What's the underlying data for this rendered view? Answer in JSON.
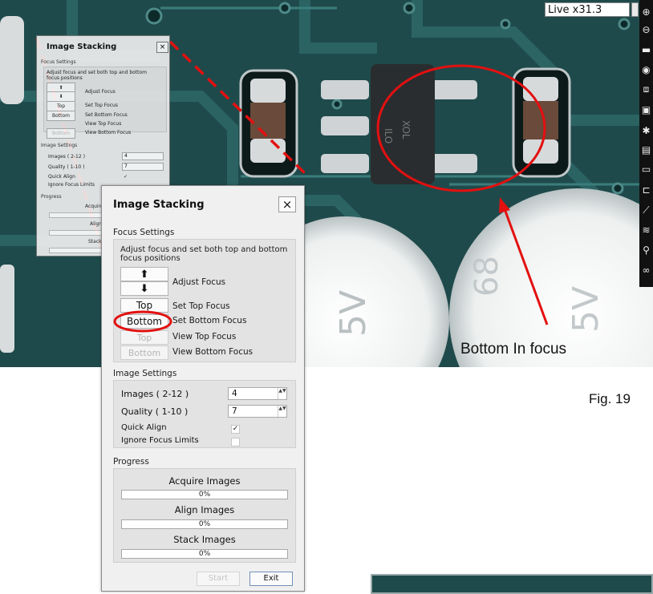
{
  "viewer": {
    "zoom": "Live x31.3",
    "toolbar_icons": [
      "zoom-in-icon",
      "zoom-out-icon",
      "toggle-icon",
      "camera-icon",
      "fit-icon",
      "expand-icon",
      "settings-icon",
      "save-icon",
      "folder-icon",
      "measure-icon",
      "ruler-icon",
      "layers-icon",
      "search-icon",
      "glasses-icon"
    ],
    "annotation_text": "Bottom In focus",
    "colors": {
      "pcb": "#1f4a4b",
      "annotation": "#e31010",
      "pads": "#cfd3d6"
    }
  },
  "mini_dialog": {
    "title": "Image Stacking",
    "close": "×",
    "focus_section": "Focus Settings",
    "hint": "Adjust focus and set both top and bottom focus positions",
    "buttons": {
      "up": "⬆",
      "down": "⬇",
      "top": "Top",
      "bottom": "Bottom",
      "bottom_dim": "Bottom"
    },
    "labels": {
      "adjust": "Adjust Focus",
      "set_top": "Set Top Focus",
      "set_bottom": "Set Bottom Focus",
      "view_top": "View Top Focus",
      "view_bottom": "View Bottom Focus"
    },
    "image_section": "Image Settings",
    "images_label": "Images ( 2-12 )",
    "images_value": "4",
    "quality_label": "Quality ( 1-10 )",
    "quality_value": "7",
    "quick_align": "Quick Align",
    "quick_align_check": "✓",
    "ignore_limits": "Ignore Focus Limits",
    "progress_section": "Progress",
    "acquire": "Acquire",
    "align": "Align",
    "stack": "Stack"
  },
  "dialog": {
    "title": "Image Stacking",
    "close": "×",
    "focus_section": "Focus Settings",
    "hint": "Adjust focus and set both top and bottom focus positions",
    "up_icon": "⬆",
    "down_icon": "⬇",
    "adjust_focus": "Adjust Focus",
    "top_button": "Top",
    "set_top": "Set Top Focus",
    "bottom_button": "Bottom",
    "set_bottom": "Set Bottom Focus",
    "top_disabled": "Top",
    "view_top": "View Top Focus",
    "bottom_disabled": "Bottom",
    "view_bottom": "View Bottom Focus",
    "image_section": "Image Settings",
    "images_label": "Images ( 2-12 )",
    "images_value": "4",
    "quality_label": "Quality ( 1-10 )",
    "quality_value": "7",
    "spin_arrows": "▲▼",
    "quick_align": "Quick Align",
    "quick_align_check": "✓",
    "ignore_limits": "Ignore Focus Limits",
    "progress_section": "Progress",
    "acquire": "Acquire Images",
    "acquire_pct": "0%",
    "acquire_progress": 0,
    "align": "Align Images",
    "align_pct": "0%",
    "align_progress": 0,
    "stack": "Stack Images",
    "stack_pct": "0%",
    "stack_progress": 0,
    "start": "Start",
    "exit": "Exit"
  },
  "figure_label": "Fig. 19"
}
